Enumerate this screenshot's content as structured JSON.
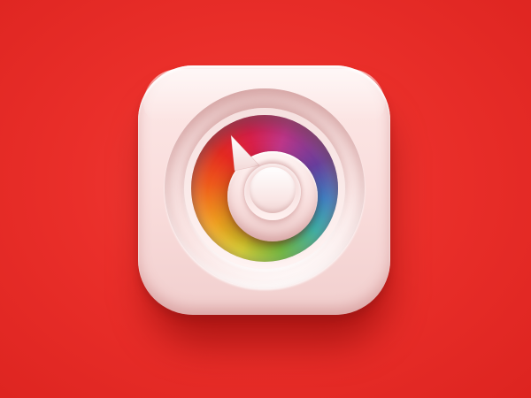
{
  "scene": {
    "background_color": "#ea2f2a",
    "subject": "color-dial-app-icon"
  },
  "icon": {
    "tile_color": "#fbe3e2",
    "knob_color": "#fbe9e8",
    "pointer_color": "#ffffff",
    "wheel_colors": [
      "#c0378a",
      "#6a3fa0",
      "#3a7fc4",
      "#2fb3a8",
      "#6cc63a",
      "#d7d12a",
      "#f2a11e",
      "#ef5a1c",
      "#e52a22",
      "#d9204a"
    ]
  }
}
